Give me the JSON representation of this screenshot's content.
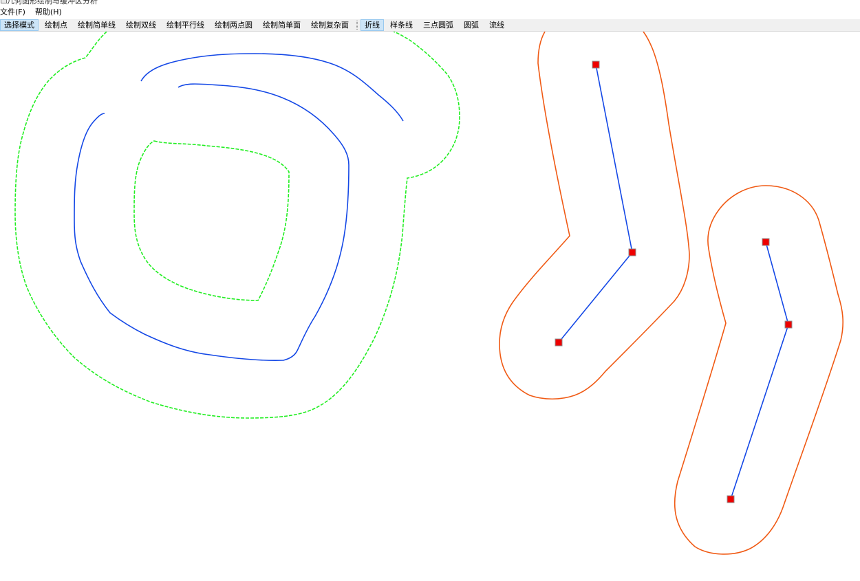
{
  "window": {
    "title": "几何图形绘制与缓冲区分析"
  },
  "menu": [
    {
      "label": "文件(F)"
    },
    {
      "label": "帮助(H)"
    }
  ],
  "toolbar": {
    "draw_tools": [
      {
        "label": "选择模式",
        "active": true
      },
      {
        "label": "绘制点",
        "active": false
      },
      {
        "label": "绘制简单线",
        "active": false
      },
      {
        "label": "绘制双线",
        "active": false
      },
      {
        "label": "绘制平行线",
        "active": false
      },
      {
        "label": "绘制两点圆",
        "active": false
      },
      {
        "label": "绘制简单面",
        "active": false
      },
      {
        "label": "绘制复杂面",
        "active": false
      }
    ],
    "line_types": [
      {
        "label": "折线",
        "active": true
      },
      {
        "label": "样条线",
        "active": false
      },
      {
        "label": "三点圆弧",
        "active": false
      },
      {
        "label": "圆弧",
        "active": false
      },
      {
        "label": "流线",
        "active": false
      }
    ]
  },
  "colors": {
    "line": "#1448e6",
    "buffer_green": "#22ee22",
    "buffer_orange": "#f05a14",
    "vertex": "#ee0000",
    "toolbar_active": "#cce4f7"
  }
}
